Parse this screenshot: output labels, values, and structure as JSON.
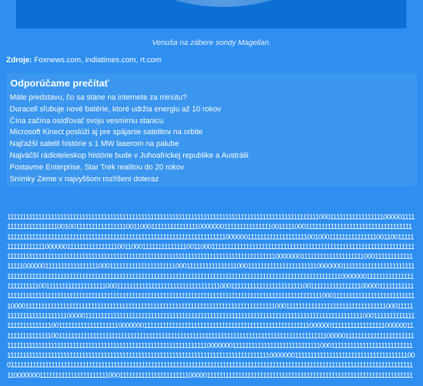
{
  "caption": "Venuša na zábere sondy Magellan.",
  "source": {
    "label": "Zdroje:",
    "text": "Foxnews.com, indiatimes.com, rt.com"
  },
  "recommended": {
    "title": "Odporúčame prečítať",
    "items": [
      "Máte predstavu, čo sa stane na internete za minútu?",
      "Duracell sľubuje nové batérie, ktoré udržia energiu až 10 rokov",
      "Čína začína osídľovať svoju vesmírnu stanicu",
      "Microsoft Kinect poslúži aj pre spájanie satelitov na orbite",
      "Najťažší satelit histórie s 1 MW laserom na palube",
      "Najväčší rádioteleskop histórie bude v Juhoafrickej republike a Austrálii",
      "Postavme Enterprise, Star Trek realitou do 20 rokov",
      "Snímky Zeme v najvyššom rozlíšení doteraz"
    ]
  },
  "binary_text": "1111111111111111111111111111111111111111111111111111111111111111111111111111111111111111111111111111000111111111111111110000011111111111111111111001001111111111111111001100011111111111111100000001111111111111110011111000111111111111111111111111111111111111111111111111111111111111111111111111111111111111111111111111111111110000001111111111111111111001000111111111111111001100111111111111111110000001111111111111111001100011111111111111001100011111111111111111111111111111111111111111111111111111111111111111111111111111111111111111111111111111111111111111111111111111111111111111111111111111110000000111111111111111111110001111111111111111100000011111111111111111000111111111111111111111000111111111111111100011111111111111111111110000000111111111111111111111111111111111111111111111111111111111111111111111111111111111111111111111111111111111111111111111111111111111100000001111111111111111111111111001111111111111111111000111111111111111111111111111111111000111111111111111111111110011111111111111110000011111111111111111111111111111111111111111111111111111111111111111111111111111111111111111111111111111111111111110001111111111111111111111111110000111111111111111111111111111111111111111111111111111111111111111111111111111111110001111111111111111111111111111111100011111111111111111111111100000111111111111111111111111111111111111111111111111111111111111111111111111111111111111111110001111111111111111111111111110011111111111111111110000000111111111111111111111111111111111111111111111111111110000001111111111111111100000011111111111111110011111111111111111111111111111111111111111111111111111111111111111111111111111111111111000001111111111111111111111111111111111111111111111111111111111111111111111111111111111111100000001111111111111111111111111111000111111111111111111111111111111111111111111111111111111111111111111111111111111111111111111111111111111111111110000000111111111111111111111111111111111111000111111111111111111111111111111111111111111111111111111111111111111111111111111111111111111111111111111111111111111111111111111111110000000111111111111111111111100011111111111111111111110000011111111111111111111111111111111111111111111111111111111111111111111"
}
